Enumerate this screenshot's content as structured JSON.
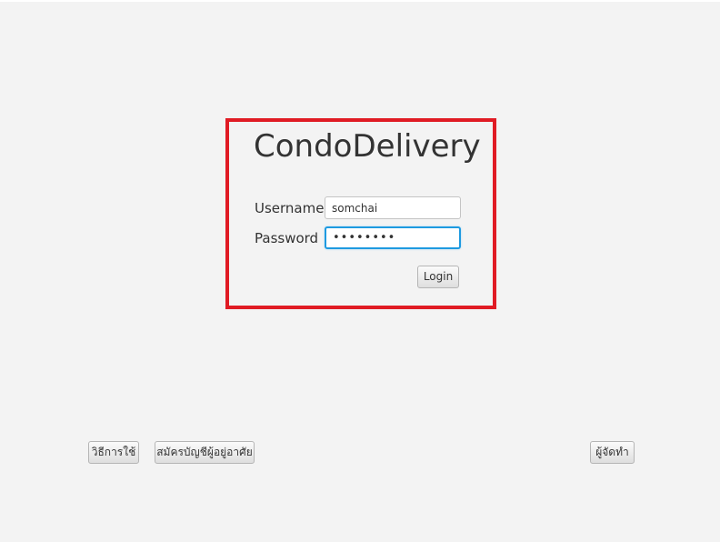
{
  "app": {
    "title": "CondoDelivery"
  },
  "login_form": {
    "username_label": "Username",
    "username_value": "somchai",
    "password_label": "Password",
    "password_mask": "••••••••",
    "login_button": "Login"
  },
  "footer": {
    "howto_button": "วิธีการใช้",
    "register_button": "สมัครบัญชีผู้อยู่อาศัย",
    "courier_button": "ผู้จัดทำ"
  },
  "colors": {
    "highlight_border": "#e01b24",
    "focus_border": "#1e9ae0",
    "background": "#f3f3f3"
  }
}
